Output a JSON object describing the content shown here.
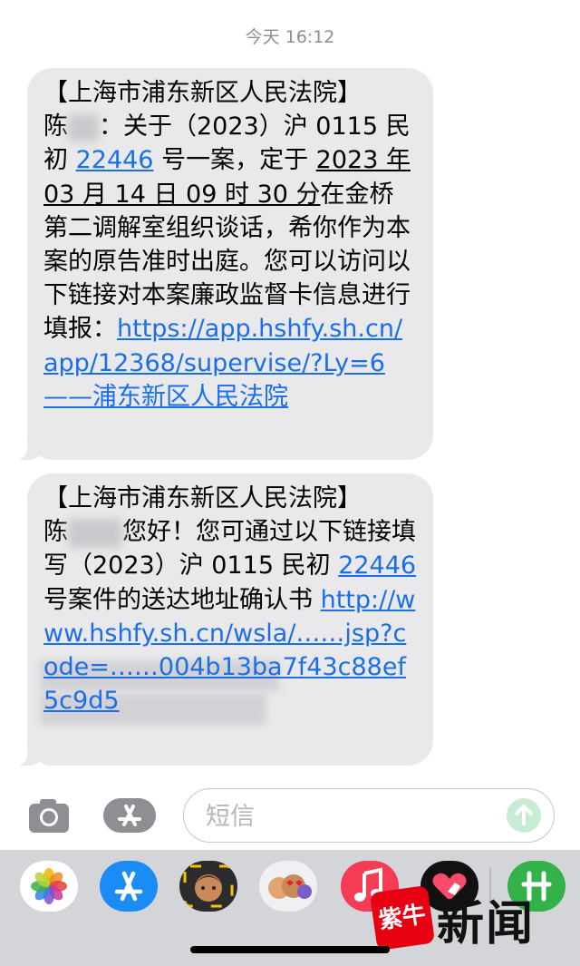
{
  "timestamp": "今天 16:12",
  "messages": [
    {
      "line1": "【上海市浦东新区人民法院】",
      "name_start": "陈",
      "text_a": "：关于（2023）沪 0115 民初 ",
      "case_no": "22446",
      "text_b": " 号一案，定于 ",
      "datetime": "2023 年 03 月 14 日 09 时 30 分",
      "text_c": "在金桥第二调解室组织谈话，希你作为本案的原告准时出庭。您可以访问以下链接对本案廉政监督卡信息进行填报：",
      "link": "https://app.hshfy.sh.cn/app/12368/supervise/?Ly=6——浦东新区人民法院"
    },
    {
      "line1": "【上海市浦东新区人民法院】",
      "name_start": "陈",
      "text_a": "您好！您可通过以下链接填写（2023）沪 0115 民初 ",
      "case_no": "22446",
      "text_b": " 号案件的送达地址确认书 ",
      "link_a": "http://www.hshfy.sh.cn/",
      "link_b": "wsla/……jsp?",
      "link_c": "code=……004b13ba7",
      "link_d": "f43c88ef5c9d5"
    }
  ],
  "input": {
    "placeholder": "短信"
  },
  "watermark": {
    "logo": "紫牛",
    "text": "新闻"
  },
  "colors": {
    "bubble": "#e9e9eb",
    "link": "#1a6fe8",
    "send": "#34c759"
  }
}
